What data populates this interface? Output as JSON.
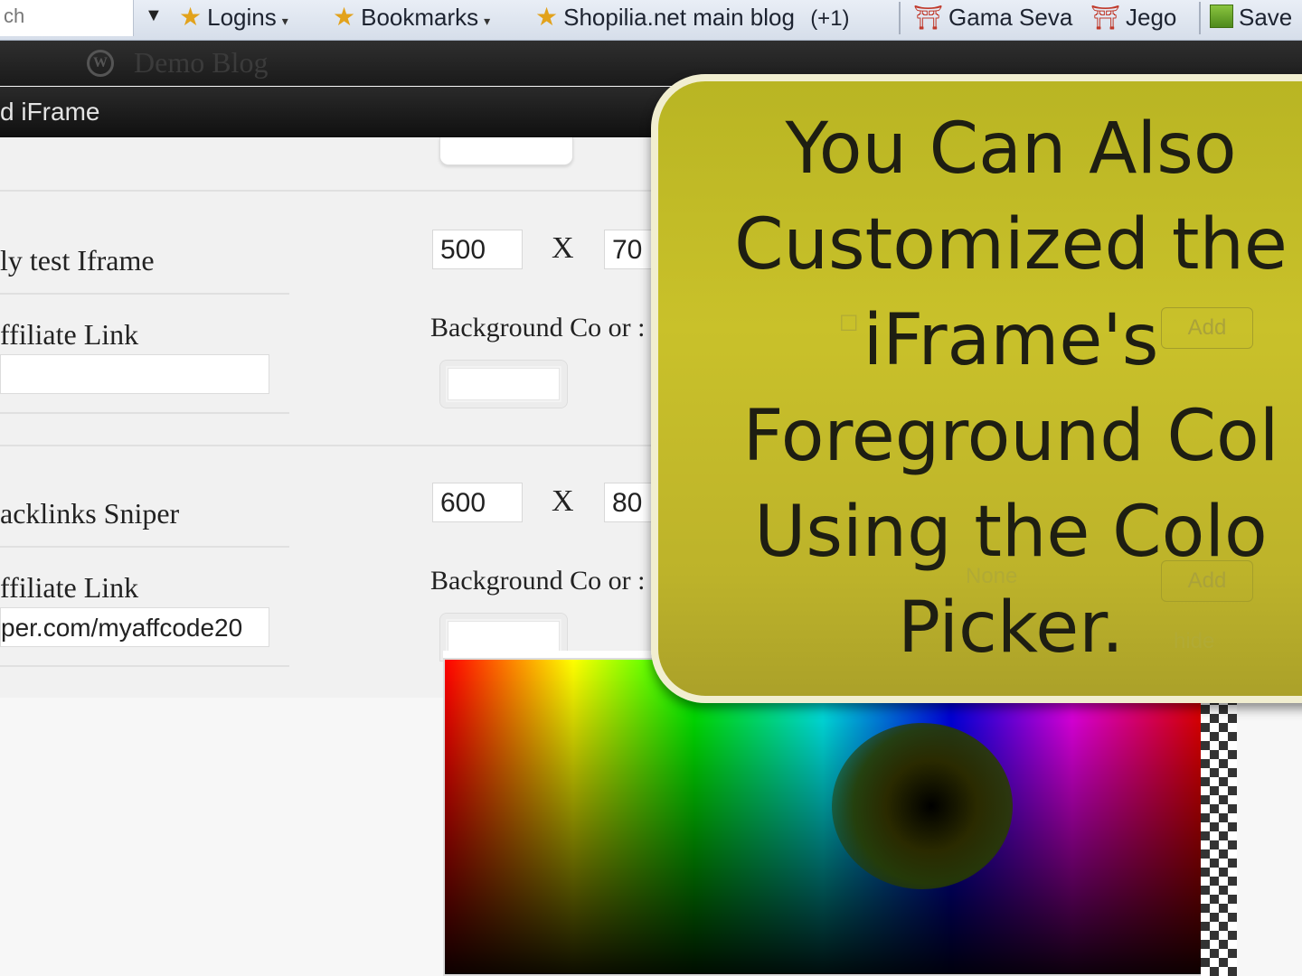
{
  "browser": {
    "search_fragment": "ch",
    "bookmarks": [
      {
        "label": "Logins",
        "has_menu": true
      },
      {
        "label": "Bookmarks",
        "has_menu": true
      },
      {
        "label": "Shopilia.net main blog",
        "badge": "(+1)"
      },
      {
        "label": "Gama Seva"
      },
      {
        "label": "Jego"
      },
      {
        "label": "Save"
      }
    ]
  },
  "admin_bar": {
    "site_name": "Demo Blog"
  },
  "dialog": {
    "title": "d iFrame"
  },
  "iframes": [
    {
      "name": "ly test Iframe",
      "link_label": "ffiliate Link",
      "link_value": "",
      "width": "500",
      "height": "70",
      "bg_color_label": "Background Co  or :"
    },
    {
      "name": "acklinks Sniper",
      "link_label": "ffiliate Link",
      "link_value": "per.com/myaffcode20",
      "width": "600",
      "height": "80",
      "bg_color_label": "Background Co  or :"
    }
  ],
  "separator": "X",
  "hidden_controls": {
    "select_value": "None",
    "add_label": "Add",
    "child_label": "hide"
  },
  "callout": {
    "lines": [
      "You Can Also",
      "Customized the",
      "iFrame's",
      "Foreground Col",
      "Using the Colo",
      "Picker."
    ]
  },
  "colors": {
    "callout_bg": "#c3bb28",
    "admin_bar": "#222222",
    "picker_border": "#dddddd"
  }
}
